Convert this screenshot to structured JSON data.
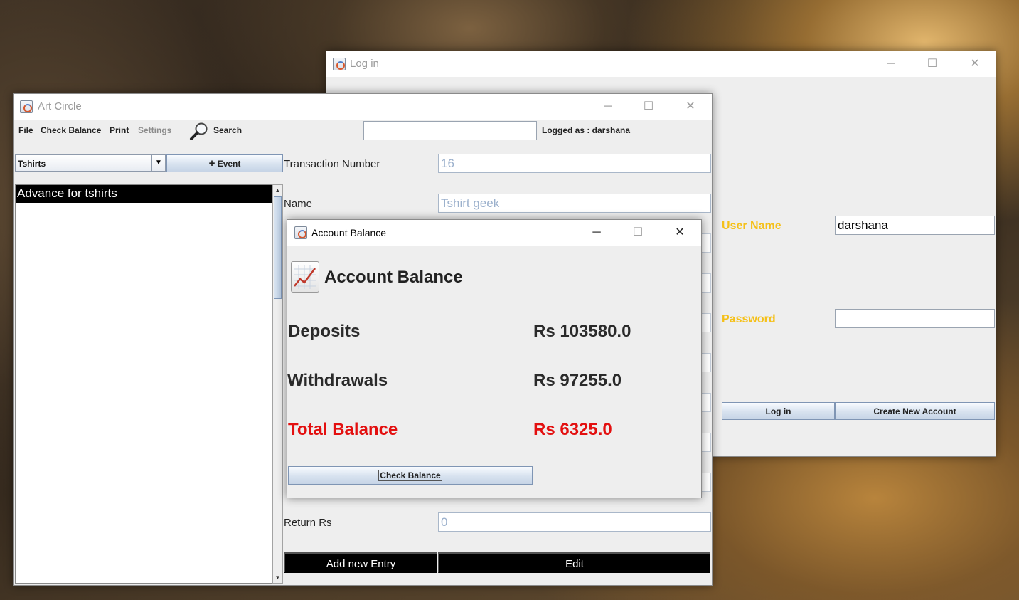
{
  "login_window": {
    "title": "Log in",
    "username_label": "User Name",
    "username_value": "darshana",
    "password_label": "Password",
    "password_value": "",
    "login_button": "Log in",
    "create_account_button": "Create New Account",
    "label_color": "#f5c018"
  },
  "art_window": {
    "title": "Art Circle",
    "menu": {
      "file": "File",
      "check_balance": "Check Balance",
      "print": "Print",
      "settings": "Settings",
      "search": "Search"
    },
    "search_value": "",
    "logged_as": "Logged as : darshana",
    "category_selected": "Tshirts",
    "event_button": "Event",
    "list_items": [
      "Advance for tshirts"
    ],
    "fields": {
      "transaction_number_label": "Transaction Number",
      "transaction_number_value": "16",
      "name_label": "Name",
      "name_value": "Tshirt geek",
      "return_label": "Return Rs",
      "return_value": "0"
    },
    "add_entry_button": "Add new Entry",
    "edit_button": "Edit"
  },
  "balance_dialog": {
    "title": "Account Balance",
    "heading": "Account Balance",
    "deposits_label": "Deposits",
    "deposits_value": "Rs 103580.0",
    "withdrawals_label": "Withdrawals",
    "withdrawals_value": "Rs 97255.0",
    "total_label": "Total Balance",
    "total_value": "Rs 6325.0",
    "check_button": "Check Balance",
    "total_color": "#e30f0f"
  }
}
